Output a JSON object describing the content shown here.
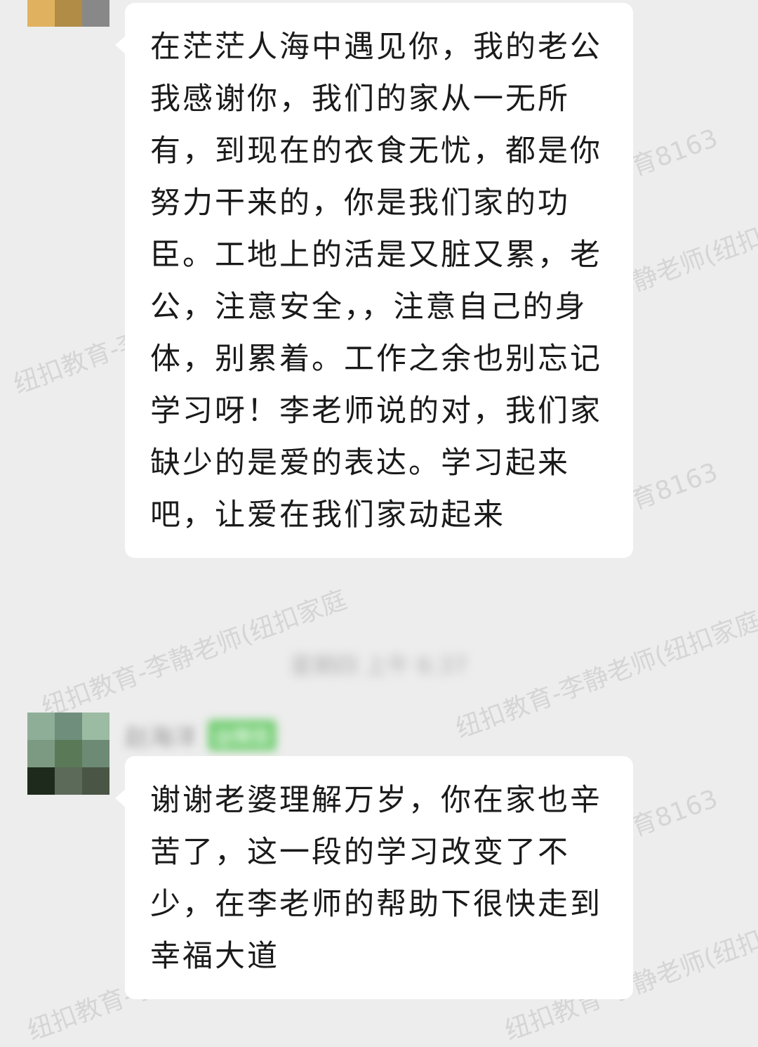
{
  "messages": [
    {
      "text": "在茫茫人海中遇见你，我的老公我感谢你，我们的家从一无所有，到现在的衣食无忧，都是你努力干来的，你是我们家的功臣。工地上的活是又脏又累，老公，注意安全，，注意自己的身体，别累着。工作之余也别忘记学习呀！李老师说的对，我们家缺少的是爱的表达。学习起来吧，让爱在我们家动起来",
      "avatar_colors": [
        "#c9a25f",
        "#8b4a1a",
        "#3d3a12",
        "#e0b25f",
        "#b08c46",
        "#888888"
      ]
    },
    {
      "text": "谢谢老婆理解万岁，你在家也辛苦了，这一段的学习改变了不少，在李老师的帮助下很快走到幸福大道",
      "avatar_colors": [
        "#8fae98",
        "#6f8f7c",
        "#9bbba2",
        "#7c9a82",
        "#5a7a57",
        "#6d8a75",
        "#1e2a1c",
        "#5c6a59",
        "#4a5545"
      ]
    }
  ],
  "time_divider": "星期四 上午 6:37",
  "sender": {
    "name": "赵海洋",
    "tag": "@微信"
  },
  "watermarks": [
    "纽扣教育-李静老师(纽扣家庭",
    "纽扣教育-李静老师(纽扣家庭",
    "纽扣教育-李静老师(纽扣家庭",
    "育8163",
    "育8163",
    "育8163",
    "纽扣教育-李静老师(纽扣家庭",
    "纽扣教育-李静老师(纽扣家庭",
    "纽扣教育-李静老师(纽扣家庭"
  ]
}
